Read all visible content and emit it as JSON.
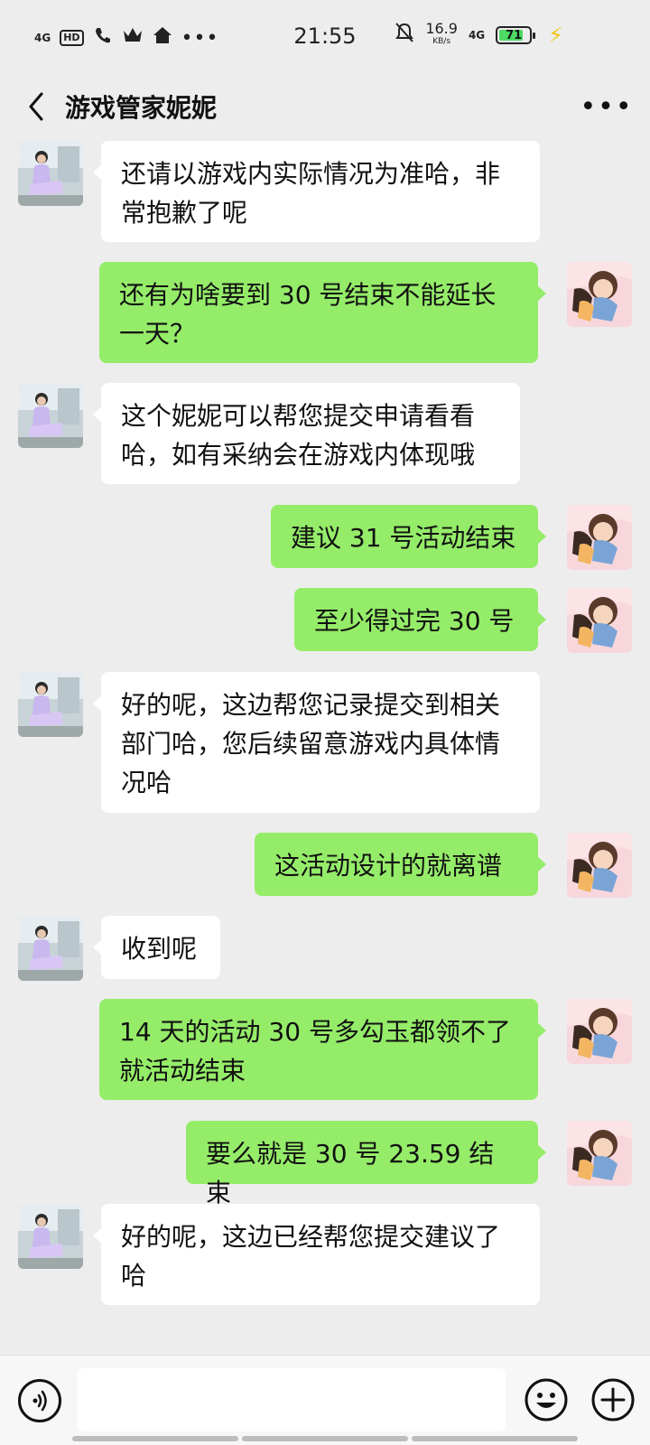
{
  "status_bar": {
    "time": "21:55",
    "network_left": "4G",
    "hd_label": "HD",
    "speed_value": "16.9",
    "speed_unit": "KB/s",
    "network_right": "4G",
    "battery": "71",
    "icons": [
      "signal-icon",
      "hd-icon",
      "call-icon",
      "crown-icon",
      "home-icon",
      "more-dots-icon",
      "mute-icon",
      "battery-icon",
      "charging-icon"
    ]
  },
  "header": {
    "title": "游戏管家妮妮",
    "back_icon": "chevron-left-icon",
    "more_icon": "more-horizontal-icon"
  },
  "messages": [
    {
      "side": "left",
      "text": "还请以游戏内实际情况为准哈，非\n常抱歉了呢"
    },
    {
      "side": "right",
      "text": "还有为啥要到 30 号结束不能延长\n一天？"
    },
    {
      "side": "left",
      "text": "这个妮妮可以帮您提交申请看看\n哈，如有采纳会在游戏内体现哦"
    },
    {
      "side": "right",
      "text": "建议 31 号活动结束"
    },
    {
      "side": "right",
      "text": "至少得过完 30 号"
    },
    {
      "side": "left",
      "text": "好的呢，这边帮您记录提交到相关\n部门哈，您后续留意游戏内具体情\n况哈"
    },
    {
      "side": "right",
      "text": "这活动设计的就离谱"
    },
    {
      "side": "left",
      "text": "收到呢"
    },
    {
      "side": "right",
      "text": "14 天的活动 30 号多勾玉都领不了\n就活动结束"
    },
    {
      "side": "right",
      "text": "要么就是 30 号 23.59 结束"
    },
    {
      "side": "left",
      "text": "好的呢，这边已经帮您提交建议了\n哈"
    }
  ],
  "input_bar": {
    "placeholder": "",
    "voice_icon": "voice-icon",
    "emoji_icon": "emoji-icon",
    "add_icon": "plus-icon"
  },
  "colors": {
    "background": "#ededed",
    "bubble_self": "#95ec69",
    "bubble_other": "#ffffff",
    "battery_fill": "#4cd964",
    "charging": "#f5c518"
  }
}
